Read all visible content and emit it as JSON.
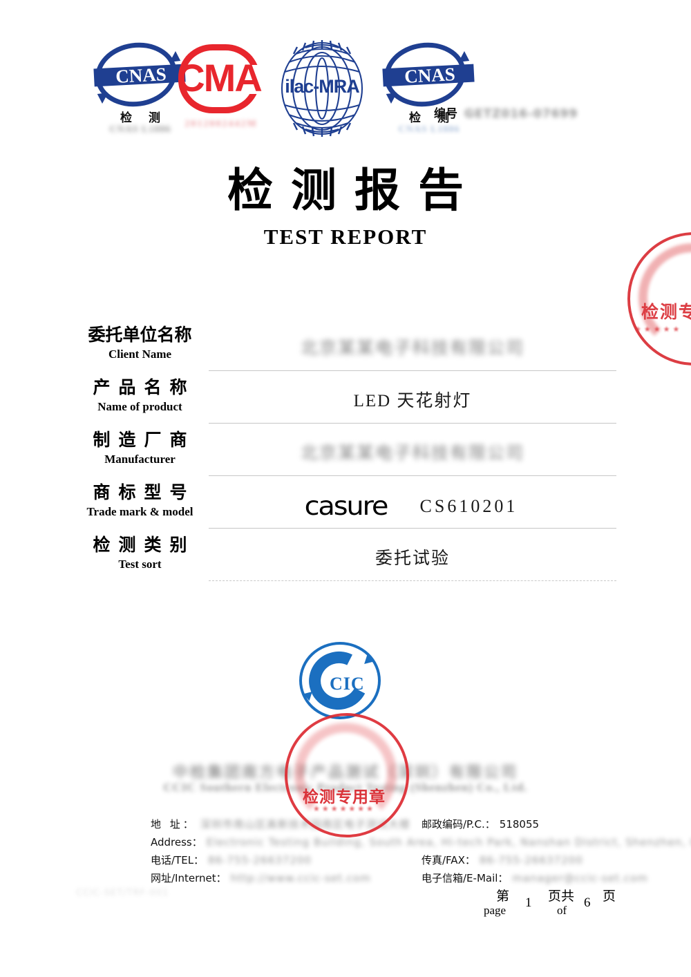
{
  "header": {
    "logos": [
      {
        "name": "CNAS",
        "sub_cn": "检 测",
        "sub_code": "CNAS L1886"
      },
      {
        "name": "CMA",
        "sub_code": "2012002442M"
      },
      {
        "name": "ilac-MRA"
      },
      {
        "name": "CNAS",
        "sub_cn": "检 测",
        "sub_code": "CNAS L1886"
      }
    ],
    "report_no_label": "编号",
    "report_no_value": "GETZ016-07699"
  },
  "title": {
    "cn": "检测报告",
    "en": "TEST   REPORT"
  },
  "form": {
    "rows": [
      {
        "label_cn": "委托单位名称",
        "label_en": "Client Name",
        "value": "北京某某电子科技有限公司",
        "redacted": true
      },
      {
        "label_cn": "产品名称",
        "label_en": "Name of product",
        "value": "LED 天花射灯",
        "redacted": false
      },
      {
        "label_cn": "制造厂商",
        "label_en": "Manufacturer",
        "value": "北京某某电子科技有限公司",
        "redacted": true
      },
      {
        "label_cn": "商标型号",
        "label_en": "Trade mark & model",
        "brand": "casure",
        "model": "CS610201",
        "redacted": false
      },
      {
        "label_cn": "检测类别",
        "label_en": "Test sort",
        "value": "委托试验",
        "redacted": false
      }
    ]
  },
  "cic_logo": {
    "text": "CIC"
  },
  "company": {
    "name_cn": "中检集团南方电子产品测试（深圳）有限公司",
    "name_en": "CCIC Southern Electronic Product Testing (Shenzhen) Co., Ltd."
  },
  "contact": {
    "address_label_cn": "地  址：",
    "address_label_en": "Address：",
    "address_cn": "深圳市南山区高新技术园南区电子测试大楼",
    "address_en": "Electronic Testing Building, South Area, Hi-tech Park, Nanshan District, Shenzhen, China",
    "address_en_cont": "Nan District, Shenzhen, China",
    "postcode_label": "邮政编码/P.C.：",
    "postcode_value": "518055",
    "tel_label": "电话/TEL：",
    "tel_value": "86-755-26637200",
    "fax_label": "传真/FAX：",
    "fax_value": "86-755-26637200",
    "web_label": "网址/Internet：",
    "web_value": "http://www.ccic-set.com",
    "email_label": "电子信箱/E-Mail：",
    "email_value": "manager@ccic-set.com"
  },
  "footer": {
    "doc_code": "CCIC-SET/TRF-001",
    "page_cn_prefix": "第",
    "page_en_prefix": "page",
    "page_current": "1",
    "page_cn_mid": "页共",
    "page_en_mid": "of",
    "page_total": "6",
    "page_cn_suffix": "页"
  },
  "seals": {
    "top_right": {
      "text": "检测专",
      "stars": "★★★★★"
    },
    "center": {
      "text": "检测专用章",
      "bottom": "★★★★★★★"
    }
  },
  "colors": {
    "cnas_blue": "#1f3f91",
    "cma_red": "#e8262d",
    "cic_blue": "#1b6fc0",
    "seal_red": "#d8232a"
  }
}
